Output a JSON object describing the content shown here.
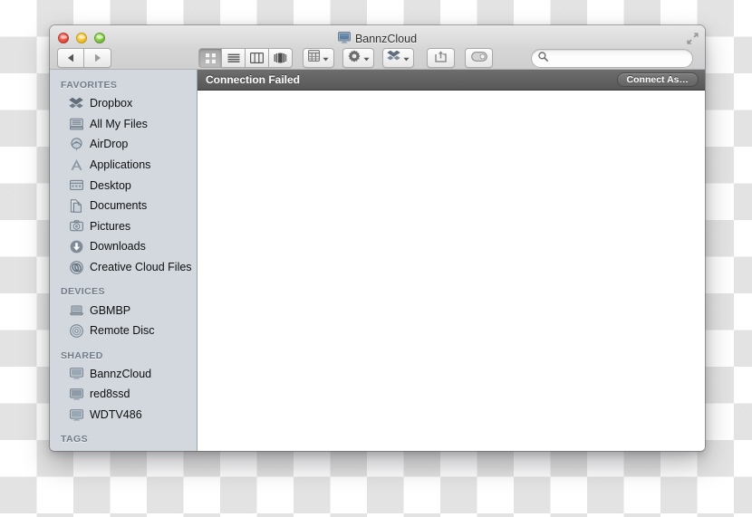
{
  "window": {
    "title": "BannzCloud",
    "title_icon": "monitor-icon",
    "traffic_lights": [
      {
        "name": "close",
        "color": "#e74c3c"
      },
      {
        "name": "minimize",
        "color": "#f4c030"
      },
      {
        "name": "zoom",
        "color": "#7dc242"
      }
    ],
    "fullscreen_icon": "fullscreen-expand-icon"
  },
  "toolbar": {
    "back_icon": "chevron-left-icon",
    "forward_icon": "chevron-right-icon",
    "view_modes": [
      {
        "name": "icon-view",
        "icon": "grid-icon",
        "active": true
      },
      {
        "name": "list-view",
        "icon": "list-icon",
        "active": false
      },
      {
        "name": "column-view",
        "icon": "columns-icon",
        "active": false
      },
      {
        "name": "coverflow-view",
        "icon": "coverflow-icon",
        "active": false
      }
    ],
    "arrange_icon": "arrange-grid-icon",
    "action_icon": "gear-icon",
    "dropbox_icon": "dropbox-icon",
    "share_icon": "share-arrow-icon",
    "tag_icon": "tag-pill-icon"
  },
  "search": {
    "icon": "search-icon",
    "value": "",
    "placeholder": ""
  },
  "sidebar": {
    "sections": [
      {
        "header": "FAVORITES",
        "items": [
          {
            "label": "Dropbox",
            "icon": "dropbox-icon"
          },
          {
            "label": "All My Files",
            "icon": "all-my-files-icon"
          },
          {
            "label": "AirDrop",
            "icon": "airdrop-icon"
          },
          {
            "label": "Applications",
            "icon": "applications-icon"
          },
          {
            "label": "Desktop",
            "icon": "desktop-icon"
          },
          {
            "label": "Documents",
            "icon": "documents-icon"
          },
          {
            "label": "Pictures",
            "icon": "pictures-icon"
          },
          {
            "label": "Downloads",
            "icon": "downloads-icon"
          },
          {
            "label": "Creative Cloud Files",
            "icon": "creative-cloud-icon"
          }
        ]
      },
      {
        "header": "DEVICES",
        "items": [
          {
            "label": "GBMBP",
            "icon": "laptop-icon"
          },
          {
            "label": "Remote Disc",
            "icon": "disc-icon"
          }
        ]
      },
      {
        "header": "SHARED",
        "items": [
          {
            "label": "BannzCloud",
            "icon": "monitor-icon"
          },
          {
            "label": "red8ssd",
            "icon": "monitor-icon"
          },
          {
            "label": "WDTV486",
            "icon": "monitor-icon"
          }
        ]
      },
      {
        "header": "TAGS",
        "items": []
      }
    ]
  },
  "status": {
    "message": "Connection Failed",
    "connect_button": "Connect As…"
  },
  "colors": {
    "sidebar_bg": "#d3d8de",
    "status_bar": "#636363",
    "content_bg": "#ffffff",
    "titlebar": "#d6d6d6"
  }
}
